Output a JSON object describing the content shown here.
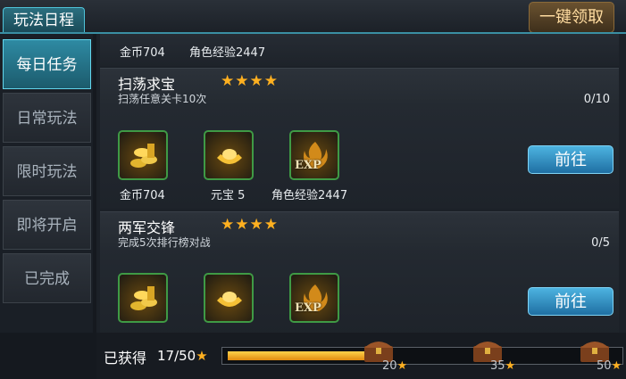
{
  "header": {
    "tab_title": "玩法日程",
    "claim_all_label": "一键领取"
  },
  "sidebar": {
    "items": [
      {
        "label": "每日任务",
        "active": true
      },
      {
        "label": "日常玩法",
        "active": false
      },
      {
        "label": "限时玩法",
        "active": false
      },
      {
        "label": "即将开启",
        "active": false
      },
      {
        "label": "已完成",
        "active": false
      }
    ]
  },
  "partial_card": {
    "rewards": [
      {
        "label": "金币704"
      },
      {
        "label": "角色经验2447"
      }
    ]
  },
  "tasks": [
    {
      "title": "扫荡求宝",
      "stars": "★★★★",
      "desc": "扫荡任意关卡10次",
      "count": "0/10",
      "rewards": [
        {
          "icon": "gold-coins-icon",
          "label": "金币704"
        },
        {
          "icon": "gold-ingot-icon",
          "label": "元宝 5"
        },
        {
          "icon": "exp-icon",
          "label": "角色经验2447",
          "badge": "EXP"
        }
      ],
      "go_label": "前往"
    },
    {
      "title": "两军交锋",
      "stars": "★★★★",
      "desc": "完成5次排行榜对战",
      "count": "0/5",
      "rewards": [
        {
          "icon": "gold-coins-icon"
        },
        {
          "icon": "gold-ingot-icon"
        },
        {
          "icon": "exp-icon",
          "badge": "EXP"
        }
      ],
      "go_label": "前往"
    }
  ],
  "progress": {
    "label": "已获得",
    "count": "17/50",
    "value": 17,
    "max": 50,
    "milestones": [
      {
        "value": "20"
      },
      {
        "value": "35"
      },
      {
        "value": "50"
      }
    ]
  },
  "colors": {
    "accent": "#4fc3d9",
    "star": "#ffb020",
    "button": "#2f8fc6",
    "reward_border": "#3f9a45"
  }
}
